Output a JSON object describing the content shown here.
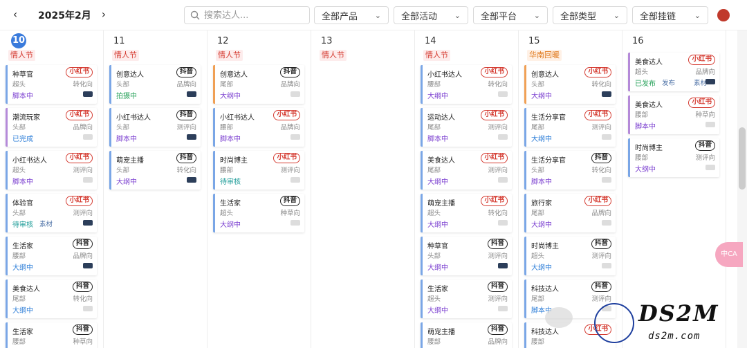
{
  "toolbar": {
    "prev": "‹",
    "next": "›",
    "month": "2025年2月",
    "search_placeholder": "搜索达人...",
    "filters": [
      "全部产品",
      "全部活动",
      "全部平台",
      "全部类型",
      "全部挂链"
    ]
  },
  "days": [
    {
      "num": "10",
      "today": true,
      "holiday": "情人节",
      "holiday_color": "red",
      "cards": [
        {
          "name": "种草官",
          "platform": "小红书",
          "tier": "超头",
          "dir": "转化向",
          "status": "脚本中",
          "status_color": "purple",
          "border": "blue",
          "tool": "dark"
        },
        {
          "name": "潮流玩家",
          "platform": "小红书",
          "tier": "头部",
          "dir": "品牌向",
          "status": "已完成",
          "status_color": "blue",
          "border": "purple",
          "tool": "light"
        },
        {
          "name": "小红书达人",
          "platform": "小红书",
          "tier": "超头",
          "dir": "测评向",
          "status": "脚本中",
          "status_color": "purple",
          "border": "blue",
          "tool": "light"
        },
        {
          "name": "体验官",
          "platform": "小红书",
          "tier": "头部",
          "dir": "测评向",
          "status": "待审核",
          "status_color": "teal",
          "border": "blue",
          "tool": "dark",
          "extra": "素材"
        },
        {
          "name": "生活家",
          "platform": "抖音",
          "tier": "腰部",
          "dir": "品牌向",
          "status": "大纲中",
          "status_color": "blue",
          "border": "blue",
          "tool": "dark"
        },
        {
          "name": "美食达人",
          "platform": "抖音",
          "tier": "尾部",
          "dir": "转化向",
          "status": "大纲中",
          "status_color": "blue",
          "border": "blue",
          "tool": "light"
        },
        {
          "name": "生活家",
          "platform": "抖音",
          "tier": "腰部",
          "dir": "种草向",
          "status": "",
          "status_color": "blue",
          "border": "blue",
          "tool": "light"
        }
      ]
    },
    {
      "num": "11",
      "today": false,
      "holiday": "情人节",
      "holiday_color": "red",
      "cards": [
        {
          "name": "创意达人",
          "platform": "抖音",
          "tier": "头部",
          "dir": "品牌向",
          "status": "拍摄中",
          "status_color": "green",
          "border": "blue",
          "tool": "dark"
        },
        {
          "name": "小红书达人",
          "platform": "抖音",
          "tier": "头部",
          "dir": "测评向",
          "status": "脚本中",
          "status_color": "purple",
          "border": "blue",
          "tool": "dark"
        },
        {
          "name": "萌宠主播",
          "platform": "抖音",
          "tier": "头部",
          "dir": "转化向",
          "status": "大纲中",
          "status_color": "purple",
          "border": "blue",
          "tool": "dark"
        }
      ]
    },
    {
      "num": "12",
      "today": false,
      "holiday": "情人节",
      "holiday_color": "red",
      "cards": [
        {
          "name": "创意达人",
          "platform": "抖音",
          "tier": "尾部",
          "dir": "品牌向",
          "status": "大纲中",
          "status_color": "purple",
          "border": "orange",
          "tool": "light"
        },
        {
          "name": "小红书达人",
          "platform": "小红书",
          "tier": "腰部",
          "dir": "品牌向",
          "status": "脚本中",
          "status_color": "purple",
          "border": "blue",
          "tool": "light"
        },
        {
          "name": "时尚博主",
          "platform": "小红书",
          "tier": "腰部",
          "dir": "测评向",
          "status": "待审核",
          "status_color": "teal",
          "border": "blue",
          "tool": "light"
        },
        {
          "name": "生活家",
          "platform": "抖音",
          "tier": "超头",
          "dir": "种草向",
          "status": "大纲中",
          "status_color": "purple",
          "border": "blue",
          "tool": "light"
        }
      ]
    },
    {
      "num": "13",
      "today": false,
      "holiday": "情人节",
      "holiday_color": "red",
      "cards": []
    },
    {
      "num": "14",
      "today": false,
      "holiday": "情人节",
      "holiday_color": "red",
      "cards": [
        {
          "name": "小红书达人",
          "platform": "小红书",
          "tier": "腰部",
          "dir": "转化向",
          "status": "大纲中",
          "status_color": "purple",
          "border": "blue",
          "tool": "light"
        },
        {
          "name": "运动达人",
          "platform": "小红书",
          "tier": "尾部",
          "dir": "测评向",
          "status": "脚本中",
          "status_color": "purple",
          "border": "blue",
          "tool": "light"
        },
        {
          "name": "美食达人",
          "platform": "小红书",
          "tier": "尾部",
          "dir": "测评向",
          "status": "大纲中",
          "status_color": "purple",
          "border": "blue",
          "tool": "light"
        },
        {
          "name": "萌宠主播",
          "platform": "小红书",
          "tier": "超头",
          "dir": "转化向",
          "status": "大纲中",
          "status_color": "purple",
          "border": "blue",
          "tool": "light"
        },
        {
          "name": "种草官",
          "platform": "抖音",
          "tier": "头部",
          "dir": "测评向",
          "status": "大纲中",
          "status_color": "purple",
          "border": "blue",
          "tool": "dark"
        },
        {
          "name": "生活家",
          "platform": "抖音",
          "tier": "超头",
          "dir": "测评向",
          "status": "大纲中",
          "status_color": "purple",
          "border": "blue",
          "tool": "light"
        },
        {
          "name": "萌宠主播",
          "platform": "抖音",
          "tier": "腰部",
          "dir": "品牌向",
          "status": "",
          "status_color": "purple",
          "border": "blue",
          "tool": "light"
        }
      ]
    },
    {
      "num": "15",
      "today": false,
      "holiday": "华南回暖",
      "holiday_color": "orange",
      "cards": [
        {
          "name": "创意达人",
          "platform": "小红书",
          "tier": "头部",
          "dir": "转化向",
          "status": "大纲中",
          "status_color": "purple",
          "border": "orange",
          "tool": "dark"
        },
        {
          "name": "生活分享官",
          "platform": "小红书",
          "tier": "尾部",
          "dir": "测评向",
          "status": "大纲中",
          "status_color": "blue",
          "border": "blue",
          "tool": "light"
        },
        {
          "name": "生活分享官",
          "platform": "抖音",
          "tier": "头部",
          "dir": "转化向",
          "status": "脚本中",
          "status_color": "purple",
          "border": "blue",
          "tool": "light"
        },
        {
          "name": "旅行家",
          "platform": "小红书",
          "tier": "尾部",
          "dir": "品牌向",
          "status": "大纲中",
          "status_color": "purple",
          "border": "blue",
          "tool": "light"
        },
        {
          "name": "时尚博主",
          "platform": "抖音",
          "tier": "超头",
          "dir": "测评向",
          "status": "大纲中",
          "status_color": "blue",
          "border": "blue",
          "tool": "light"
        },
        {
          "name": "科技达人",
          "platform": "抖音",
          "tier": "尾部",
          "dir": "测评向",
          "status": "脚本中",
          "status_color": "blue",
          "border": "blue",
          "tool": "light"
        },
        {
          "name": "科技达人",
          "platform": "小红书",
          "tier": "腰部",
          "dir": "",
          "status": "",
          "status_color": "blue",
          "border": "blue",
          "tool": "light"
        }
      ]
    },
    {
      "num": "16",
      "today": false,
      "holiday": "",
      "holiday_color": "red",
      "cards": [
        {
          "name": "美食达人",
          "platform": "小红书",
          "tier": "超头",
          "dir": "品牌向",
          "status": "已发布",
          "status_color": "green",
          "border": "purple",
          "tool": "dark",
          "extra": "发布",
          "extra2": "素材"
        },
        {
          "name": "美食达人",
          "platform": "小红书",
          "tier": "腰部",
          "dir": "种草向",
          "status": "脚本中",
          "status_color": "purple",
          "border": "purple",
          "tool": "light"
        },
        {
          "name": "时尚博主",
          "platform": "抖音",
          "tier": "腰部",
          "dir": "测评向",
          "status": "大纲中",
          "status_color": "purple",
          "border": "blue",
          "tool": "light"
        }
      ]
    }
  ],
  "float_button": "中CA",
  "watermark": {
    "title": "DS2M",
    "site": "ds2m.com"
  },
  "colors": {
    "accent": "#3a7bdc",
    "xhs": "#d4382e",
    "dy": "#222222"
  }
}
